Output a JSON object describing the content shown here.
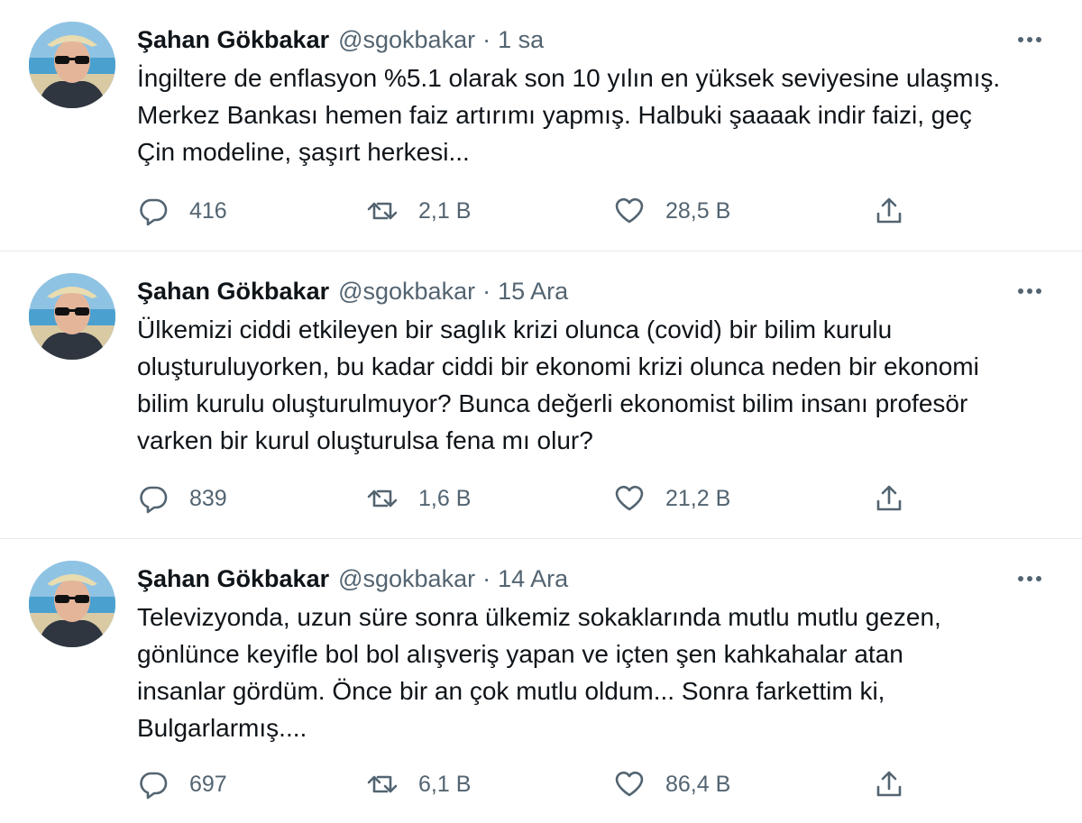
{
  "colors": {
    "text": "#0f1419",
    "muted": "#536471",
    "divider": "#e6ecf0"
  },
  "tweets": [
    {
      "author_name": "Şahan Gökbakar",
      "handle": "@sgokbakar",
      "separator": "·",
      "time": "1 sa",
      "text_lines": [
        "İngiltere de enflasyon %5.1 olarak son 10 yılın en yüksek seviyesine ulaşmış.",
        "Merkez Bankası hemen faiz artırımı yapmış. Halbuki şaaaak indir faizi, geç",
        "Çin modeline, şaşırt herkesi..."
      ],
      "replies": "416",
      "retweets": "2,1 B",
      "likes": "28,5 B"
    },
    {
      "author_name": "Şahan Gökbakar",
      "handle": "@sgokbakar",
      "separator": "·",
      "time": "15 Ara",
      "text_lines": [
        "Ülkemizi ciddi etkileyen bir saglık krizi olunca (covid) bir bilim kurulu",
        "oluşturuluyorken, bu kadar ciddi bir ekonomi krizi olunca neden bir ekonomi",
        "bilim kurulu oluşturulmuyor? Bunca değerli ekonomist bilim insanı profesör",
        "varken bir kurul oluşturulsa fena mı olur?"
      ],
      "replies": "839",
      "retweets": "1,6 B",
      "likes": "21,2 B"
    },
    {
      "author_name": "Şahan Gökbakar",
      "handle": "@sgokbakar",
      "separator": "·",
      "time": "14 Ara",
      "text_lines": [
        "Televizyonda, uzun süre sonra ülkemiz sokaklarında mutlu mutlu gezen,",
        "gönlünce keyifle bol bol alışveriş yapan ve içten şen kahkahalar atan",
        "insanlar gördüm. Önce bir an çok mutlu oldum... Sonra farkettim ki,",
        "Bulgarlarmış...."
      ],
      "replies": "697",
      "retweets": "6,1 B",
      "likes": "86,4 B"
    }
  ],
  "icons": {
    "more": "more-horizontal-icon",
    "reply": "reply-bubble-icon",
    "retweet": "retweet-arrows-icon",
    "like": "heart-icon",
    "share": "share-upload-icon"
  }
}
